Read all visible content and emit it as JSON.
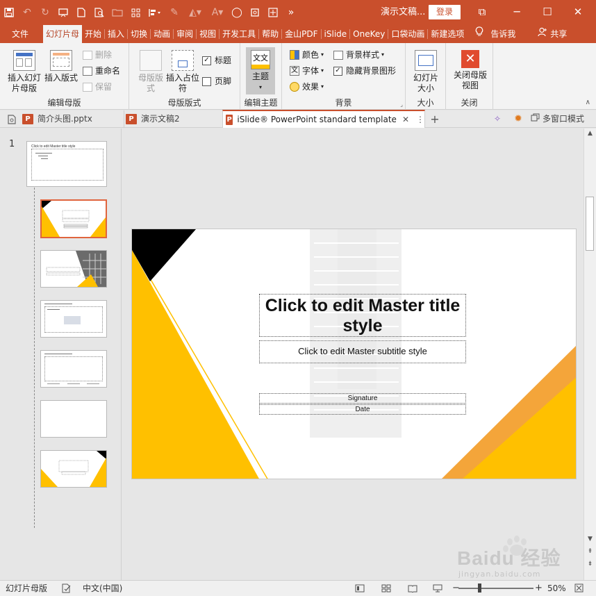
{
  "titlebar": {
    "title": "演示文稿...",
    "login": "登录",
    "qa_icons": [
      "save-icon",
      "undo-icon",
      "redo-icon",
      "present-icon",
      "new-icon",
      "print-preview-icon",
      "open-icon",
      "grid-icon",
      "align-icon",
      "pen-icon",
      "fill-icon",
      "font-icon",
      "shape-icon",
      "crop-icon",
      "dist-icon",
      "more-icon"
    ],
    "controls": {
      "restore": "⧉",
      "minimize": "─",
      "maximize": "☐",
      "close": "✕"
    }
  },
  "menu": {
    "tabs": [
      "文件",
      "幻灯片母",
      "开始",
      "插入",
      "切换",
      "动画",
      "审阅",
      "视图",
      "开发工具",
      "帮助",
      "金山PDF",
      "iSlide",
      "OneKey",
      "口袋动画",
      "新建选项"
    ],
    "active_index": 1,
    "tell_me": "告诉我",
    "share": "共享"
  },
  "ribbon": {
    "edit_master": {
      "label": "编辑母版",
      "insert_slide_master": "插入幻灯片母版",
      "insert_layout": "插入版式",
      "delete": "删除",
      "rename": "重命名",
      "preserve": "保留"
    },
    "master_layout": {
      "label": "母版版式",
      "master_layout_btn": "母版版式",
      "insert_placeholder": "插入占位符",
      "title_checkbox": "标题",
      "title_checked": true,
      "footer_checkbox": "页脚",
      "footer_checked": false
    },
    "edit_theme": {
      "label": "编辑主题",
      "theme": "主题"
    },
    "background": {
      "label": "背景",
      "colors": "颜色",
      "fonts": "字体",
      "effects": "效果",
      "bg_styles": "背景样式",
      "hide_bg": "隐藏背景图形",
      "hide_bg_checked": true
    },
    "size": {
      "label": "大小",
      "slide_size": "幻灯片大小"
    },
    "close": {
      "label": "关闭",
      "close_master": "关闭母版视图"
    }
  },
  "doctabs": {
    "tabs": [
      "简介头图.pptx",
      "演示文稿2",
      "iSlide® PowerPoint standard template"
    ],
    "active_index": 2,
    "multi_window": "多窗口模式"
  },
  "thumbnails": {
    "slide_number": "1",
    "mini_title": "Click to edit Master title style"
  },
  "slide": {
    "title": "Click to edit Master title style",
    "subtitle": "Click to edit Master subtitle style",
    "signature": "Signature",
    "date": "Date",
    "accent_color": "#ffc000",
    "dark_accent": "#000000",
    "orange_accent": "#f4a53a"
  },
  "statusbar": {
    "mode": "幻灯片母版",
    "language": "中文(中国)",
    "zoom": "50%"
  },
  "watermark": {
    "brand": "Baidu 经验",
    "url": "jingyan.baidu.com"
  }
}
